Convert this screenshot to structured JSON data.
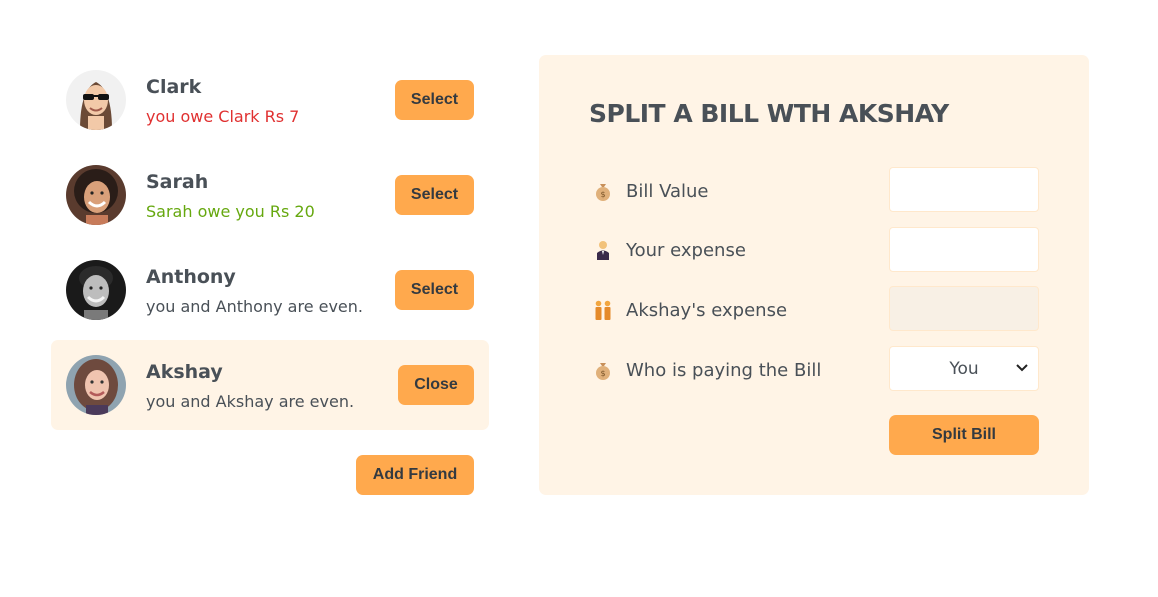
{
  "friends": [
    {
      "name": "Clark",
      "status": "you owe Clark Rs 7",
      "button": "Select"
    },
    {
      "name": "Sarah",
      "status": "Sarah owe you Rs 20",
      "button": "Select"
    },
    {
      "name": "Anthony",
      "status": "you and Anthony are even.",
      "button": "Select"
    },
    {
      "name": "Akshay",
      "status": "you and Akshay are even.",
      "button": "Close"
    }
  ],
  "add_friend_label": "Add Friend",
  "form": {
    "title": "SPLIT A BILL WTH AKSHAY",
    "bill_value_label": "Bill Value",
    "your_expense_label": "Your expense",
    "friend_expense_label": "Akshay's expense",
    "payer_label": "Who is paying the Bill",
    "payer_value": "You",
    "bill_value": "",
    "your_expense": "",
    "friend_expense": "",
    "submit_label": "Split Bill"
  },
  "colors": {
    "accent": "#ffa94d",
    "panel_bg": "#fff4e6",
    "owe_red": "#e03131",
    "owed_green": "#66a80f"
  },
  "icons": {
    "bill": "money-bag-icon",
    "you": "person-in-tuxedo-icon",
    "friend": "two-people-icon",
    "payer": "money-bag-icon"
  }
}
